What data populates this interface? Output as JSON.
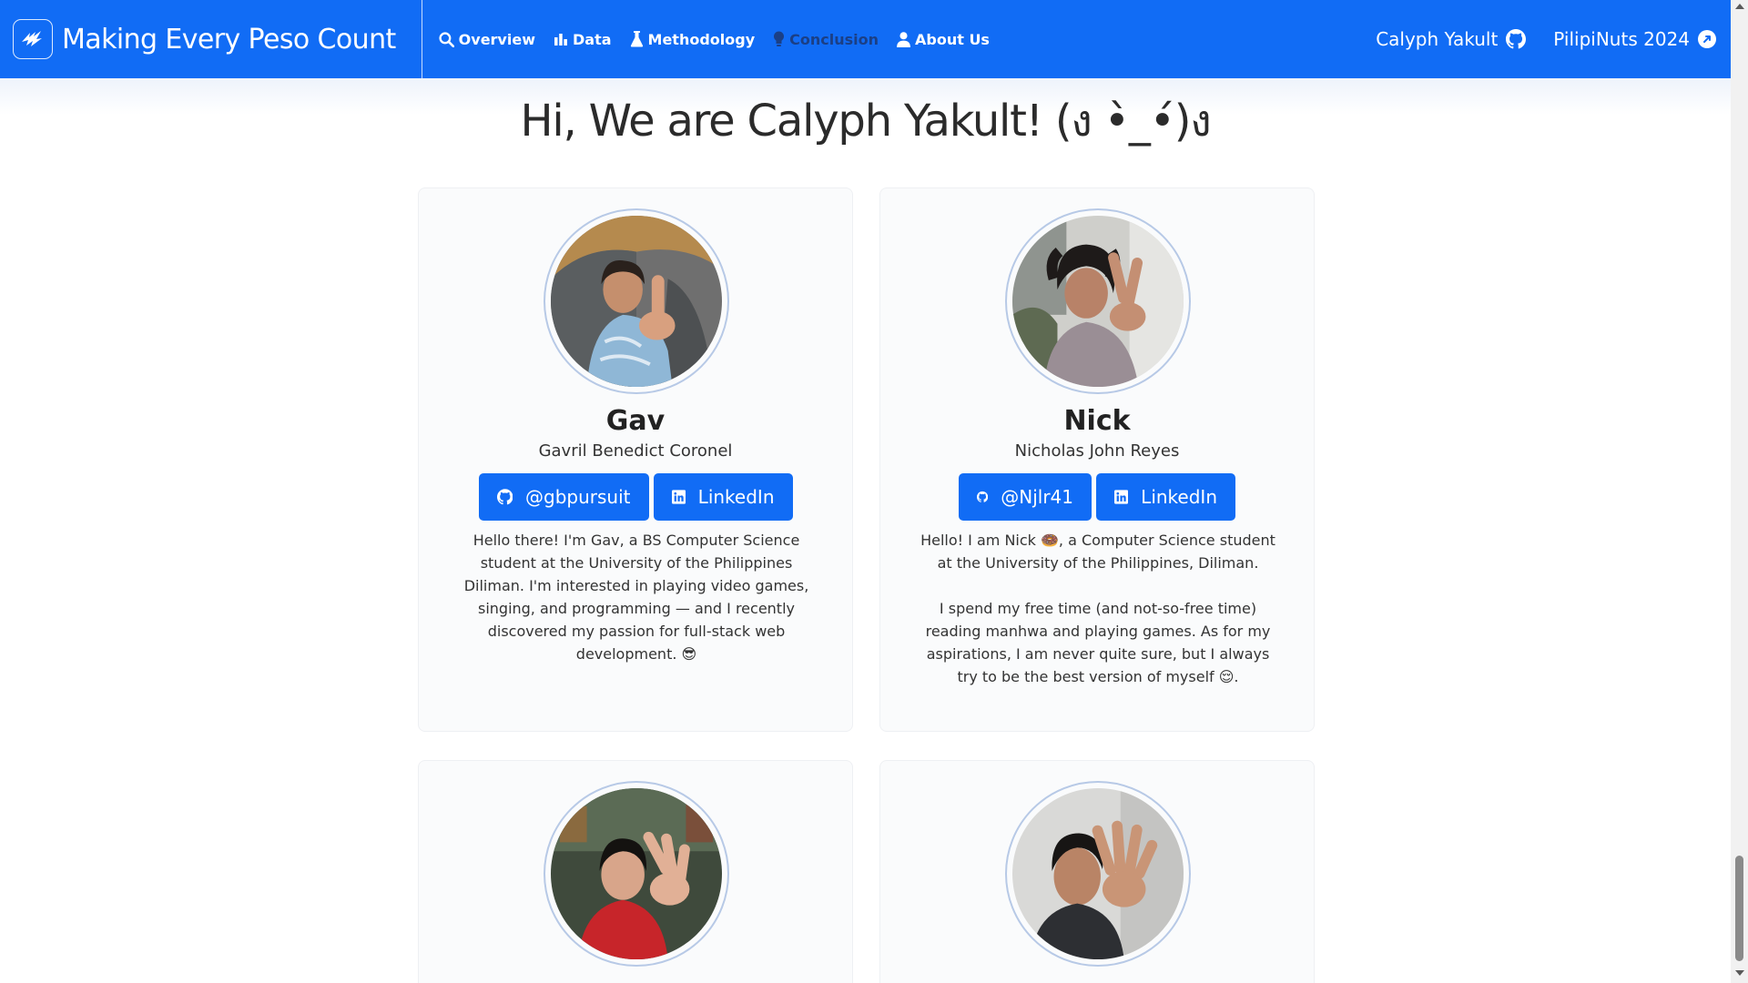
{
  "navbar": {
    "brand": "Making Every Peso Count",
    "links": [
      {
        "label": "Overview",
        "icon": "search-icon"
      },
      {
        "label": "Data",
        "icon": "bar-chart-icon"
      },
      {
        "label": "Methodology",
        "icon": "flask-icon"
      },
      {
        "label": "Conclusion",
        "icon": "lightbulb-icon"
      },
      {
        "label": "About Us",
        "icon": "person-icon"
      }
    ],
    "right": [
      {
        "label": "Calyph Yakult",
        "icon": "github-icon"
      },
      {
        "label": "PilipiNuts 2024",
        "icon": "external-link-icon"
      }
    ],
    "colors": {
      "background": "#116cf5",
      "muted_link": "#1b3f85"
    }
  },
  "heading": "Hi, We are Calyph Yakult! (ง •̀_•́)ง",
  "members": [
    {
      "nickname": "Gav",
      "fullname": "Gavril Benedict Coronel",
      "github_label": "@gbpursuit",
      "linkedin_label": "LinkedIn",
      "bio": [
        "Hello there! I'm Gav, a BS Computer Science student at the University of the Philippines Diliman. I'm interested in playing video games, singing, and programming — and I recently discovered my passion for full-stack web development. 😎"
      ]
    },
    {
      "nickname": "Nick",
      "fullname": "Nicholas John Reyes",
      "github_label": "@Njlr41",
      "linkedin_label": "LinkedIn",
      "bio": [
        "Hello! I am Nick 🍩, a Computer Science student at the University of the Philippines, Diliman.",
        "I spend my free time (and not-so-free time) reading manhwa and playing games. As for my aspirations, I am never quite sure, but I always try to be the best version of myself 😌."
      ]
    },
    {
      "nickname": "",
      "fullname": ""
    },
    {
      "nickname": "",
      "fullname": ""
    }
  ],
  "accent_color": "#116cf5"
}
